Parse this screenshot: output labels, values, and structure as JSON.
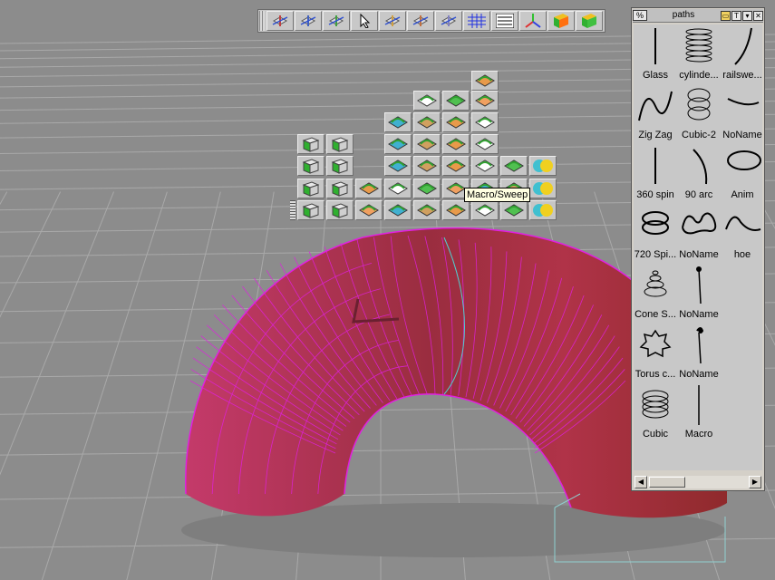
{
  "toolbar": {
    "icons": [
      "move-tool-icon",
      "rotate-tool-icon",
      "scale-tool-icon",
      "select-arrow-icon",
      "pick-object-icon",
      "pick-component-icon",
      "transform-icon",
      "grid-toggle-icon",
      "list-icon",
      "axis-icon",
      "shaded-cube-icon",
      "shaded-cube-2-icon"
    ]
  },
  "tooltip": {
    "text": "Macro/Sweep"
  },
  "paths_panel": {
    "title": "paths",
    "items": [
      {
        "label": "Glass",
        "icon": "line-path-icon"
      },
      {
        "label": "cylinde...",
        "icon": "coil-path-icon"
      },
      {
        "label": "railswe...",
        "icon": "curve-path-icon"
      },
      {
        "label": "Zig Zag",
        "icon": "zigzag-path-icon"
      },
      {
        "label": "Cubic-2",
        "icon": "cubic-spiral-icon"
      },
      {
        "label": "NoName",
        "icon": "hook-path-icon"
      },
      {
        "label": "360 spin",
        "icon": "vertical-line-icon"
      },
      {
        "label": "90 arc",
        "icon": "arc-path-icon"
      },
      {
        "label": "Anim",
        "icon": "ellipse-path-icon"
      },
      {
        "label": "720 Spi...",
        "icon": "double-spiral-icon"
      },
      {
        "label": "NoName",
        "icon": "wave-loop-icon"
      },
      {
        "label": "hoe",
        "icon": "hoe-path-icon"
      },
      {
        "label": "Cone S...",
        "icon": "cone-spiral-icon"
      },
      {
        "label": "NoName",
        "icon": "pin-path-icon"
      },
      {
        "label": "",
        "icon": "empty-cell"
      },
      {
        "label": "Torus c...",
        "icon": "torus-curve-icon"
      },
      {
        "label": "NoName",
        "icon": "curl-pin-icon"
      },
      {
        "label": "",
        "icon": "empty-cell"
      },
      {
        "label": "Cubic",
        "icon": "cubic-coil-icon"
      },
      {
        "label": "Macro",
        "icon": "macro-line-icon"
      }
    ]
  },
  "colors": {
    "torus": "#b33a55",
    "wire": "#e020e0",
    "accent_green": "#2ecc40"
  }
}
